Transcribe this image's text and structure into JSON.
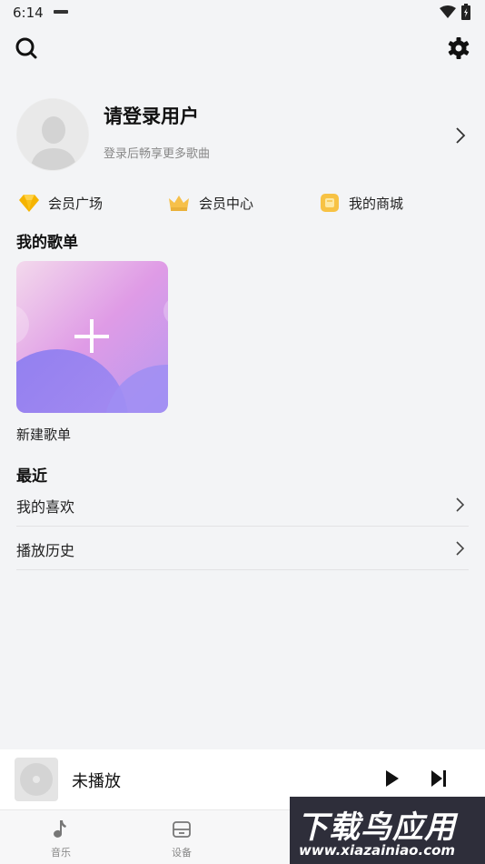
{
  "status": {
    "time": "6:14"
  },
  "profile": {
    "title": "请登录用户",
    "subtitle": "登录后畅享更多歌曲"
  },
  "vip_links": [
    {
      "label": "会员广场",
      "icon": "diamond-icon"
    },
    {
      "label": "会员中心",
      "icon": "crown-icon"
    },
    {
      "label": "我的商城",
      "icon": "shop-icon"
    }
  ],
  "playlists": {
    "section_title": "我的歌单",
    "new_label": "新建歌单"
  },
  "recent": {
    "section_title": "最近",
    "items": [
      {
        "label": "我的喜欢"
      },
      {
        "label": "播放历史"
      }
    ]
  },
  "player": {
    "title": "未播放"
  },
  "tabs": [
    {
      "label": "音乐",
      "icon": "music-note-icon"
    },
    {
      "label": "设备",
      "icon": "device-icon"
    }
  ],
  "watermark": {
    "title": "下载鸟应用",
    "url": "www.xiazainiao.com"
  },
  "colors": {
    "background": "#f3f4f6",
    "diamond": "#f5b400",
    "crown": "#f6c04a",
    "shop": "#f7c244",
    "card_gradient_start": "#f3d7ea",
    "card_gradient_end": "#9b7ff0"
  }
}
